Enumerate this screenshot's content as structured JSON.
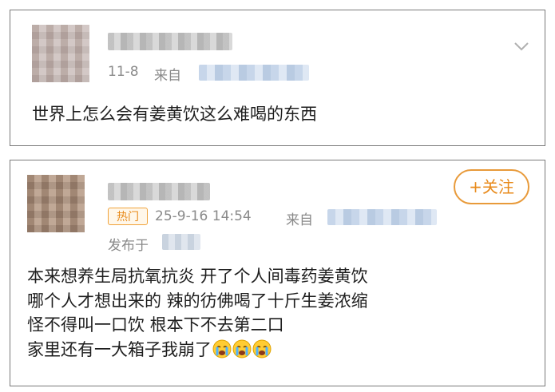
{
  "posts": [
    {
      "date": "11-8",
      "source_prefix": "来自",
      "content": "世界上怎么会有姜黄饮这么难喝的东西",
      "menu_icon": "chevron-down-icon"
    },
    {
      "badge": "热门",
      "date": "25-9-16 14:54",
      "source_prefix": "来自",
      "published_prefix": "发布于",
      "follow_label": "+关注",
      "content_lines": [
        "本来想养生局抗氧抗炎 开了个人间毒药姜黄饮",
        "哪个人才想出来的 辣的彷佛喝了十斤生姜浓缩",
        "怪不得叫一口饮 根本下不去第二口",
        "家里还有一大箱子我崩了"
      ],
      "emoji_icon": "crying-face-icon",
      "emoji_count": 3
    }
  ]
}
